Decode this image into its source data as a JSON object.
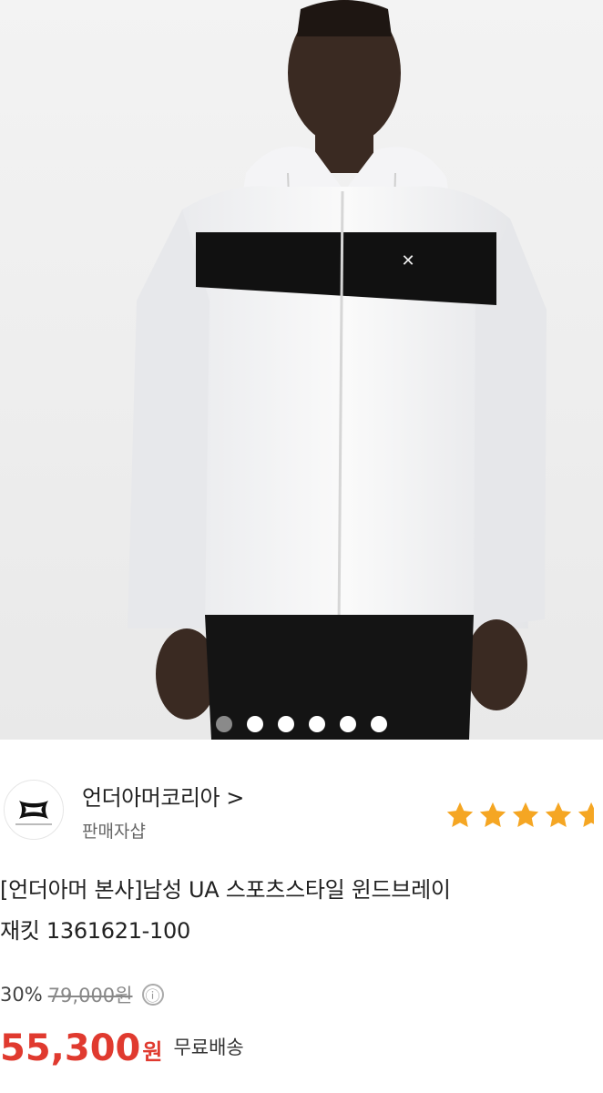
{
  "hero": {
    "alt": "product photo",
    "carousel_total": 6,
    "carousel_active": 0
  },
  "seller": {
    "name": "언더아머코리아 >",
    "subtitle": "판매자샵"
  },
  "rating": {
    "stars": 4.5
  },
  "product": {
    "title_line1": "[언더아머 본사]남성 UA 스포츠스타일 윈드브레이",
    "title_line2": "재킷 1361621-100"
  },
  "price": {
    "discount": "30%",
    "original": "79,000원",
    "info_icon": "ⓘ",
    "sale": "55,300",
    "currency": "원",
    "shipping": "무료배송"
  },
  "colors": {
    "accent": "#e03a2f",
    "star": "#f5a623"
  }
}
